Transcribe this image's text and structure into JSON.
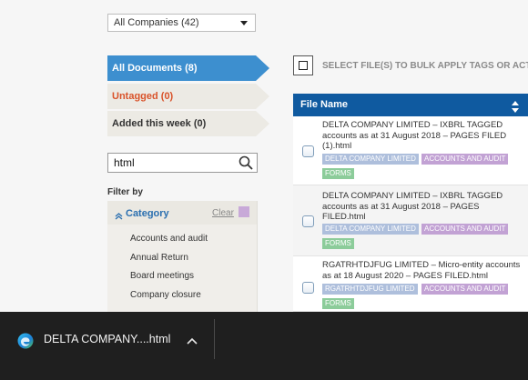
{
  "company_select": {
    "value": "All Companies (42)"
  },
  "nav": {
    "all": "All Documents (8)",
    "untagged": "Untagged (0)",
    "week": "Added this week (0)"
  },
  "search": {
    "value": "html"
  },
  "filter": {
    "label": "Filter by",
    "category_title": "Category",
    "clear": "Clear",
    "items": [
      "Accounts and audit",
      "Annual Return",
      "Board meetings",
      "Company closure"
    ]
  },
  "bulk": {
    "label": "SELECT FILE(S) TO BULK APPLY TAGS OR ACTIONS"
  },
  "table": {
    "header": "File Name",
    "rows": [
      {
        "title": "DELTA COMPANY LIMITED – IXBRL TAGGED accounts as at 31 August 2018 – PAGES FILED (1).html",
        "tags": [
          "DELTA COMPANY LIMITED",
          "ACCOUNTS AND AUDIT",
          "FORMS"
        ]
      },
      {
        "title": "DELTA COMPANY LIMITED – IXBRL TAGGED accounts as at 31 August 2018 – PAGES FILED.html",
        "tags": [
          "DELTA COMPANY LIMITED",
          "ACCOUNTS AND AUDIT",
          "FORMS"
        ]
      },
      {
        "title": "RGATRHTDJFUG LIMITED – Micro-entity accounts as at 18 August 2020 – PAGES FILED.html",
        "tags": [
          "RGATRHTDJFUG LIMITED",
          "ACCOUNTS AND AUDIT",
          "FORMS"
        ]
      }
    ]
  },
  "download": {
    "filename": "DELTA COMPANY....html",
    "icon": "edge-icon"
  },
  "colors": {
    "accent": "#3d8fcf",
    "header": "#0f5aa0",
    "untagged": "#d9532a",
    "tag_company": "#aebfdc",
    "tag_accounts": "#c2a2d4",
    "tag_forms": "#8ccc9a"
  }
}
